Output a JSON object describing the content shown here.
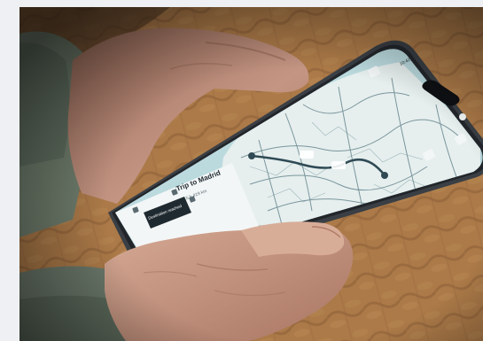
{
  "photo": {
    "subject": "hands-holding-phone-with-map",
    "palette": {
      "backdrop": "#eef0f3",
      "blanket": "#b8834e",
      "blanket_dark": "#7a5230",
      "sweater": "#6f7d6c",
      "skin": "#c89882",
      "phone_frame": "#3a3f45",
      "map_sea": "#b7d6db",
      "map_land": "#e6efee",
      "map_roads": "#5f7f88",
      "panel": "#f3f6f7",
      "accent": "#2a6cc7"
    }
  },
  "phone_screen": {
    "status_time": "10:42",
    "route_card": {
      "title": "Trip to Madrid",
      "summary": "4:15 h 419 km",
      "action_label": "Destination reached"
    },
    "map_controls": [
      "back-icon",
      "layers-icon",
      "compass-icon",
      "location-icon"
    ]
  }
}
